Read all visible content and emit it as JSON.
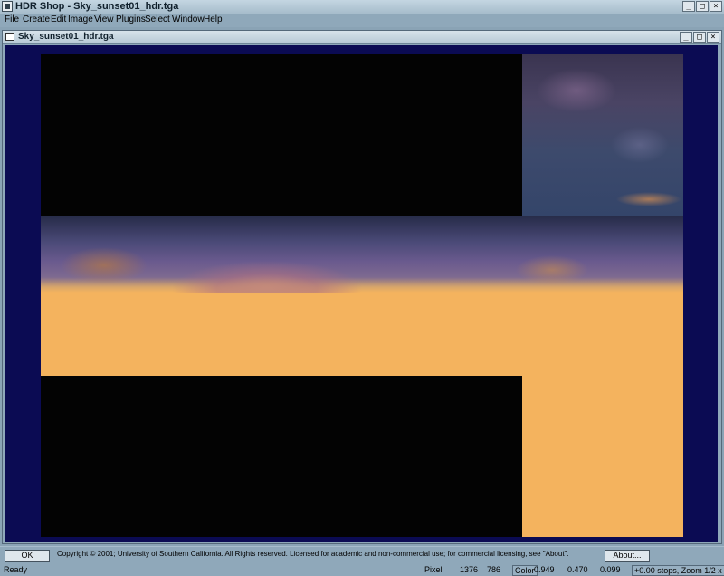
{
  "app": {
    "title": "HDR Shop - Sky_sunset01_hdr.tga",
    "window_buttons": {
      "minimize": "_",
      "maximize": "□",
      "close": "×"
    }
  },
  "menu": [
    "File",
    "Create",
    "Edit",
    "Image",
    "View",
    "Plugins",
    "Select",
    "Window",
    "Help"
  ],
  "document": {
    "title": "Sky_sunset01_hdr.tga",
    "window_buttons": {
      "minimize": "_",
      "maximize": "□",
      "close": "×"
    }
  },
  "colors": {
    "workspace_bg": "#0b0b53",
    "sunset_orange": "#f4b35e",
    "black_region": "#030303"
  },
  "bottom": {
    "ok_label": "OK",
    "copyright": "Copyright © 2001; University of Southern California.  All Rights reserved.  Licensed for academic and non-commercial use; for commercial licensing, see \"About\".",
    "about_label": "About..."
  },
  "status": {
    "ready": "Ready",
    "pixel_label": "Pixel",
    "pixel_x": "1376",
    "pixel_y": "786",
    "color_label": "Color",
    "r": "0.949",
    "g": "0.470",
    "b": "0.099",
    "exposure": "+0.00 stops, Zoom 1/2 x"
  }
}
